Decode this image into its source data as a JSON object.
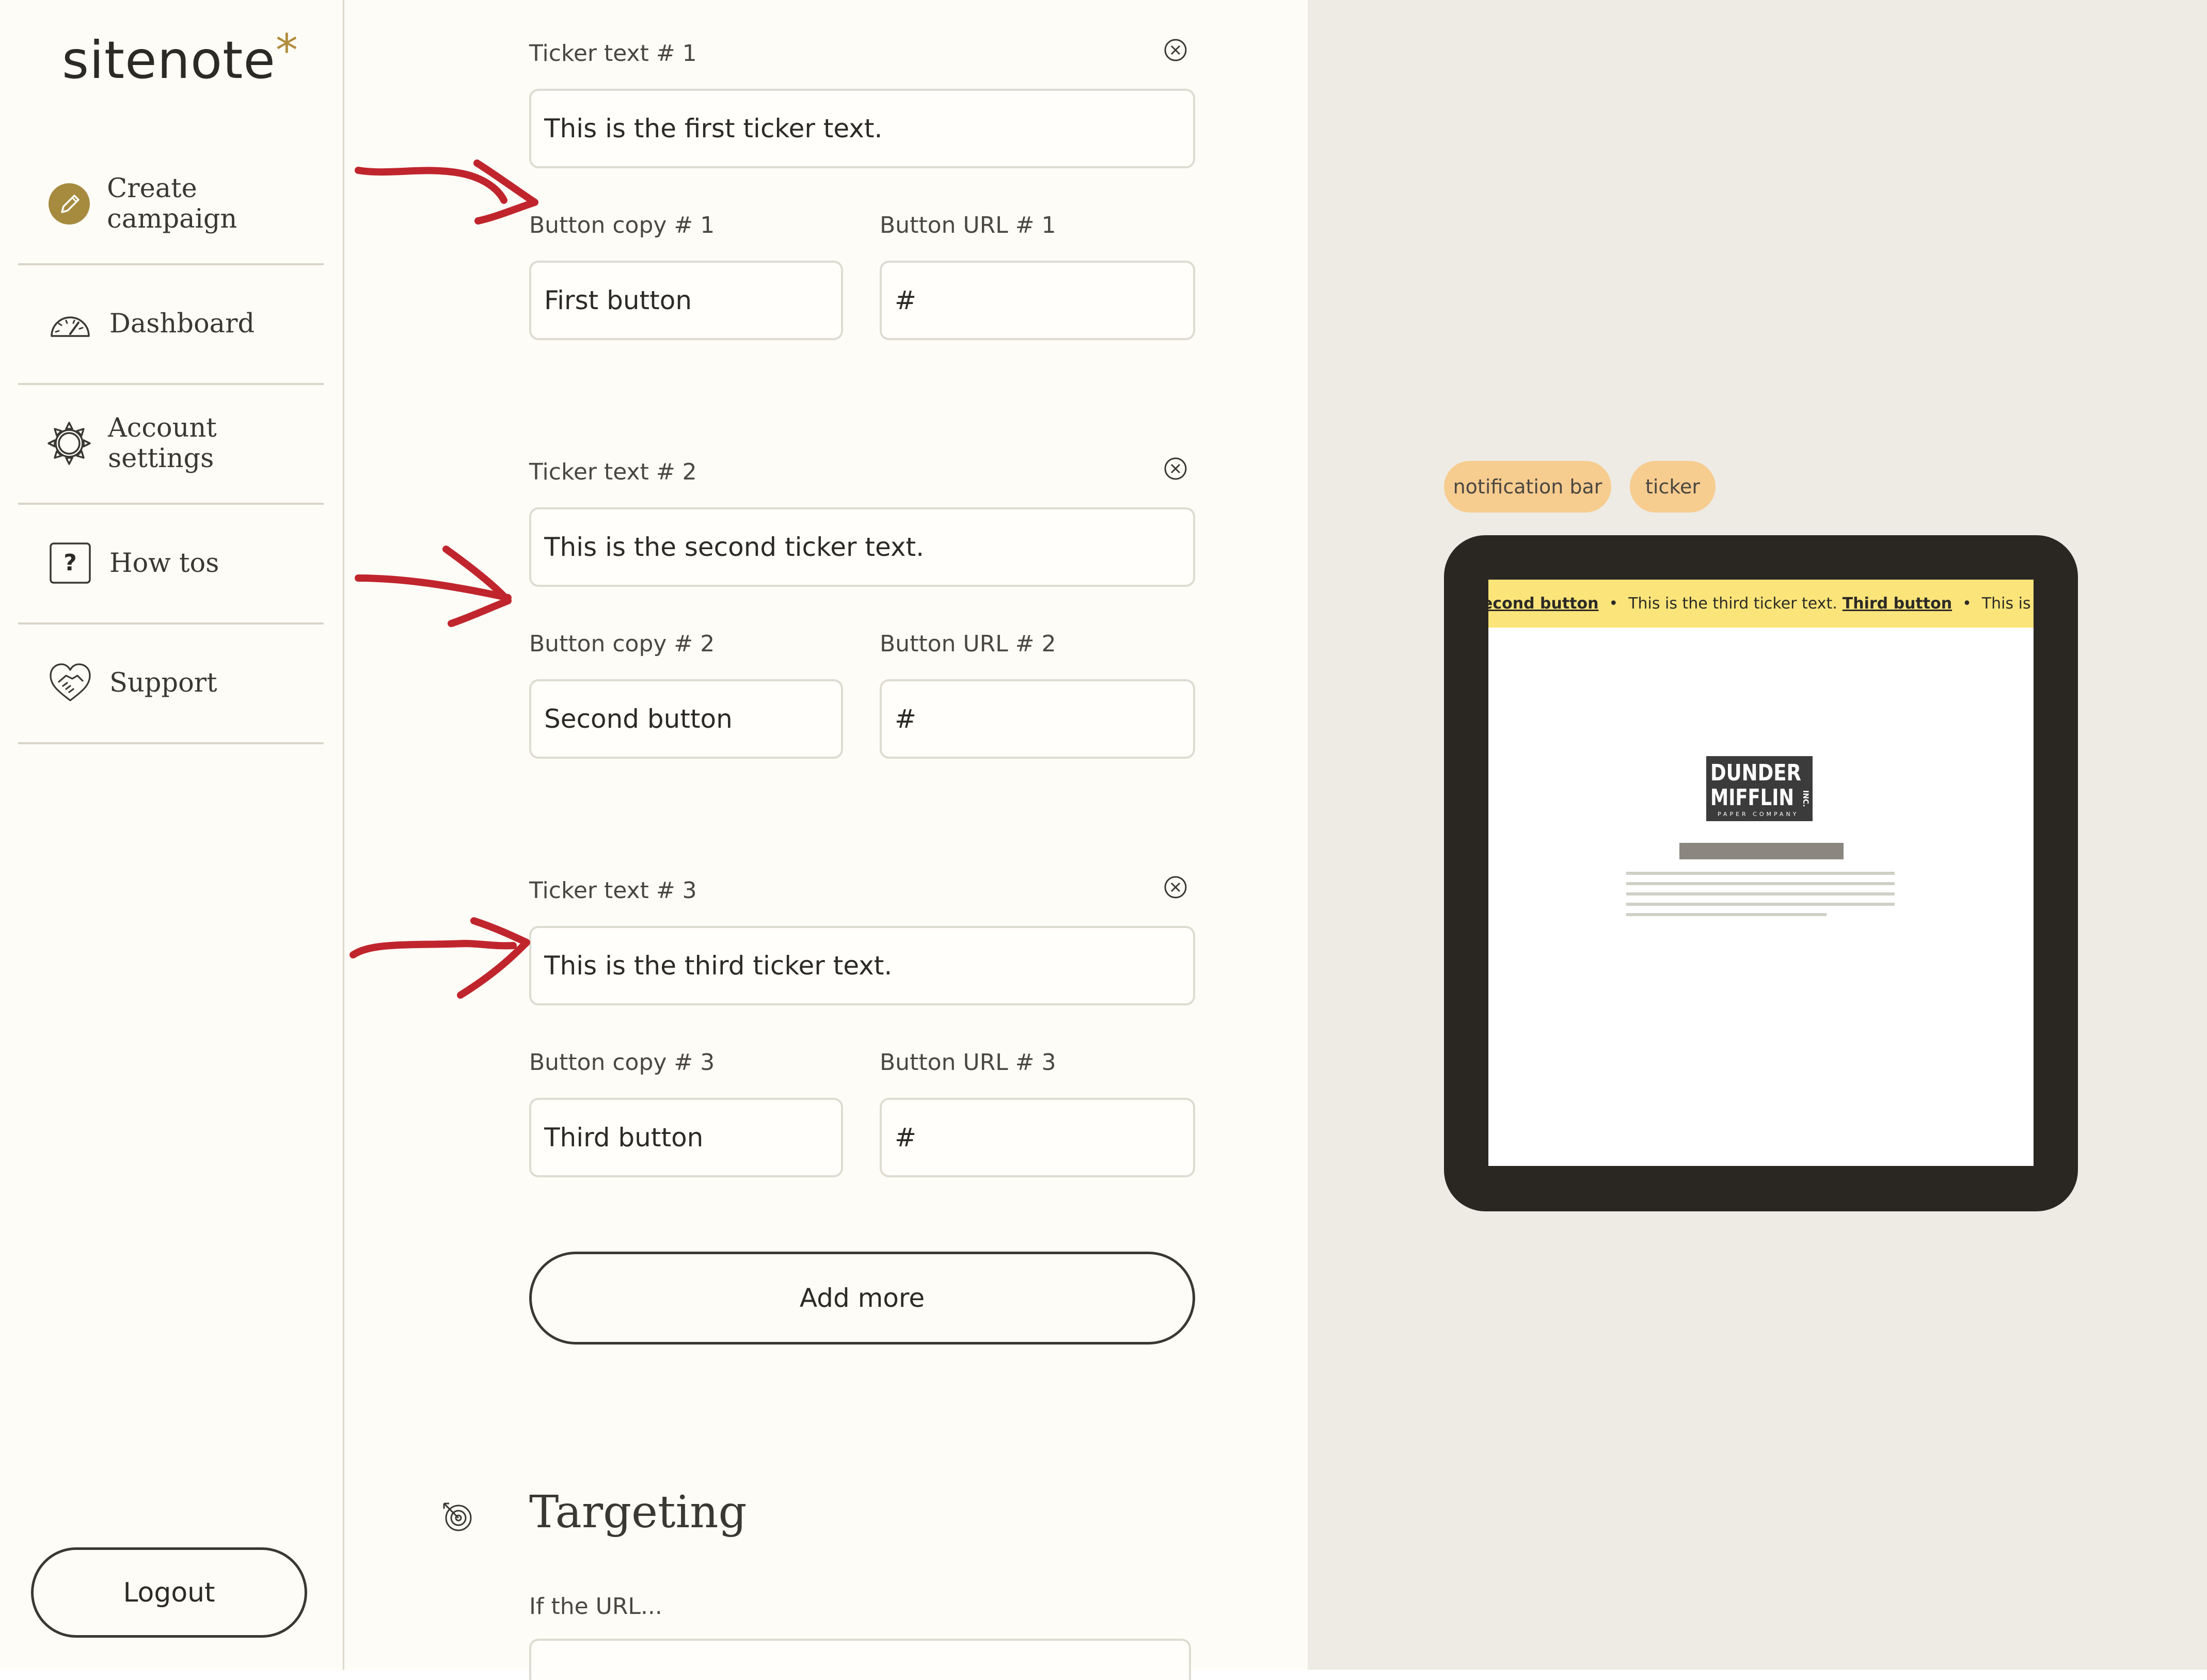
{
  "app": {
    "name": "sitenote",
    "logo_star": "*",
    "accent_color": "#b08c3c"
  },
  "sidebar": {
    "items": [
      {
        "label": "Create campaign",
        "icon": "pencil-icon",
        "active": true
      },
      {
        "label": "Dashboard",
        "icon": "speedometer-icon"
      },
      {
        "label": "Account settings",
        "icon": "gear-icon"
      },
      {
        "label": "How tos",
        "icon": "question-icon"
      },
      {
        "label": "Support",
        "icon": "handshake-icon"
      }
    ],
    "logout_label": "Logout"
  },
  "tickers": [
    {
      "text_label": "Ticker text # 1",
      "text_value": "This is the first ticker text.",
      "copy_label": "Button copy # 1",
      "copy_value": "First button",
      "url_label": "Button URL # 1",
      "url_value": "#"
    },
    {
      "text_label": "Ticker text # 2",
      "text_value": "This is the second ticker text.",
      "copy_label": "Button copy # 2",
      "copy_value": "Second button",
      "url_label": "Button URL # 2",
      "url_value": "#"
    },
    {
      "text_label": "Ticker text # 3",
      "text_value": "This is the third ticker text.",
      "copy_label": "Button copy # 3",
      "copy_value": "Third button",
      "url_label": "Button URL # 3",
      "url_value": "#"
    }
  ],
  "add_more_label": "Add more",
  "targeting": {
    "title": "Targeting",
    "icon": "target-icon",
    "url_label": "If the URL..."
  },
  "preview": {
    "tags": [
      "notification bar",
      "ticker"
    ],
    "tag_color": "#f7cc8f",
    "ticker_bar_color": "#fbe57a",
    "ticker_segments": {
      "b1": "econd button",
      "t3": "This is the third ticker text.",
      "b3": "Third button",
      "t1": "This is the f"
    },
    "brand": {
      "line1": "DUNDER",
      "line2": "MIFFLIN",
      "tag": "INC.",
      "sub": "PAPER COMPANY"
    }
  },
  "annotation_color": "#c0252d"
}
